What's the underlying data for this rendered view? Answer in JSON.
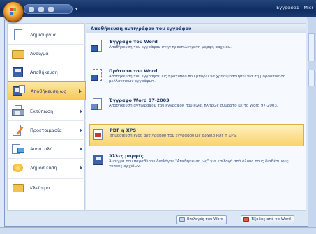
{
  "titlebar": {
    "title": "Έγγραφο1 - Micr"
  },
  "left_menu": [
    {
      "label": "Δημιουργία",
      "has_submenu": false,
      "icon": "new-document-icon"
    },
    {
      "label": "Άνοιγμα",
      "has_submenu": false,
      "icon": "open-folder-icon"
    },
    {
      "label": "Αποθήκευση",
      "has_submenu": false,
      "icon": "save-disk-icon"
    },
    {
      "label": "Αποθήκευση ως",
      "has_submenu": true,
      "icon": "save-as-icon"
    },
    {
      "label": "Εκτύπωση",
      "has_submenu": true,
      "icon": "printer-icon"
    },
    {
      "label": "Προετοιμασία",
      "has_submenu": true,
      "icon": "prepare-icon"
    },
    {
      "label": "Αποστολή",
      "has_submenu": true,
      "icon": "send-icon"
    },
    {
      "label": "Δημοσίευση",
      "has_submenu": true,
      "icon": "publish-icon"
    },
    {
      "label": "Κλείσιμο",
      "has_submenu": false,
      "icon": "close-folder-icon"
    }
  ],
  "right_panel": {
    "header": "Αποθήκευση αντιγράφου του εγγράφου",
    "options": [
      {
        "title": "Έγγραφο του Word",
        "desc": "Αποθήκευση του εγγράφου στην προεπιλεγμένη μορφή αρχείου.",
        "icon": "word-document-icon"
      },
      {
        "title": "Πρότυπο του Word",
        "desc": "Αποθήκευση του εγγράφου ως προτύπου που μπορεί να χρησιμοποιηθεί για τη μορφοποίηση μελλοντικών εγγράφων.",
        "icon": "word-template-icon"
      },
      {
        "title": "Έγγραφο Word 97-2003",
        "desc": "Αποθήκευση αντιγράφου του εγγράφου που είναι πλήρως συμβατό με το Word 97-2003.",
        "icon": "word-97-icon"
      },
      {
        "title": "PDF ή XPS",
        "desc": "Δημοσίευση ενός αντιγράφου του εγγράφου ως αρχείο PDF ή XPS.",
        "icon": "pdf-xps-icon"
      },
      {
        "title": "Άλλες μορφές",
        "desc": "Άνοιγμα του παραθύρου διαλόγου \"Αποθήκευση ως\" για επιλογή από όλους τους διαθέσιμους τύπους αρχείων.",
        "icon": "other-formats-icon"
      }
    ]
  },
  "footer": {
    "options_label": "Επιλογές του Word",
    "exit_label": "Έξοδος από το Word"
  },
  "colors": {
    "accent": "#f9c75a",
    "frame": "#0f2d63"
  }
}
